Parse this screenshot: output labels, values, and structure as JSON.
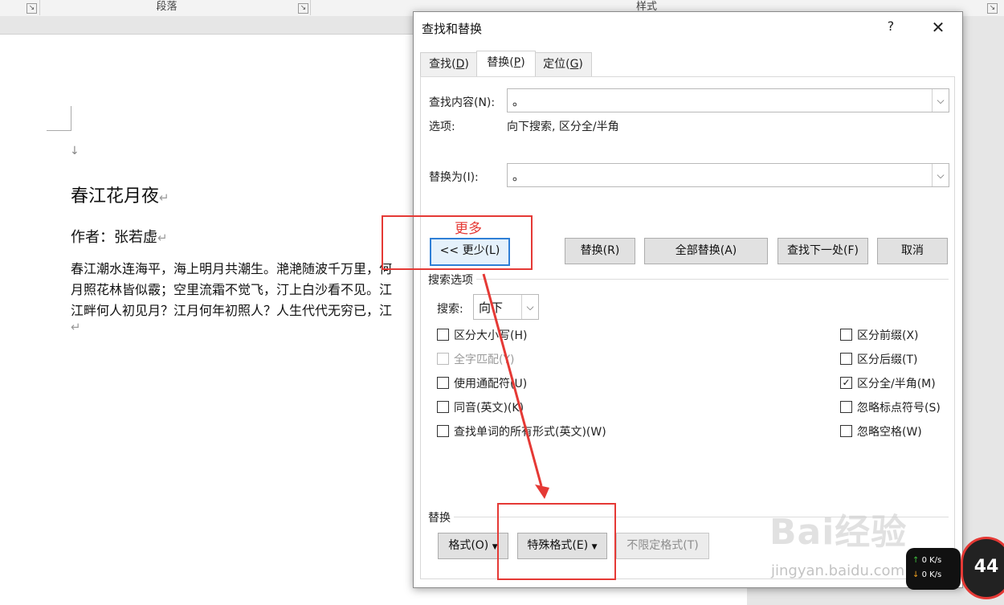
{
  "ribbon": {
    "group_paragraph": "段落",
    "group_styles": "样式",
    "launcher_glyph": "↘"
  },
  "document": {
    "title": "春江花月夜",
    "author": "作者：张若虚",
    "lines": [
      "春江潮水连海平，海上明月共潮生。滟滟随波千万里，何",
      "月照花林皆似霰；空里流霜不觉飞，汀上白沙看不见。江",
      "江畔何人初见月？江月何年初照人？人生代代无穷已，江"
    ],
    "pilcrow": "↵",
    "arrow": "↓"
  },
  "dialog": {
    "title": "查找和替换",
    "help": "?",
    "close": "✕",
    "tabs": [
      {
        "label": "查找(",
        "key": "D",
        "suffix": ")"
      },
      {
        "label": "替换(",
        "key": "P",
        "suffix": ")"
      },
      {
        "label": "定位(",
        "key": "G",
        "suffix": ")"
      }
    ],
    "find_label": "查找内容(N):",
    "find_value": "。",
    "options_label": "选项:",
    "options_value": "向下搜索, 区分全/半角",
    "replace_label": "替换为(I):",
    "replace_value": "。",
    "buttons": {
      "less": "<< 更少(L)",
      "replace": "替换(R)",
      "replace_all": "全部替换(A)",
      "find_next": "查找下一处(F)",
      "cancel": "取消"
    },
    "search_options_title": "搜索选项",
    "search_label": "搜索:",
    "search_value": "向下",
    "left_checks": [
      {
        "label": "区分大小写(H)",
        "checked": false,
        "disabled": false
      },
      {
        "label": "全字匹配(Y)",
        "checked": false,
        "disabled": true
      },
      {
        "label": "使用通配符(U)",
        "checked": false,
        "disabled": false
      },
      {
        "label": "同音(英文)(K)",
        "checked": false,
        "disabled": false
      },
      {
        "label": "查找单词的所有形式(英文)(W)",
        "checked": false,
        "disabled": false
      }
    ],
    "right_checks": [
      {
        "label": "区分前缀(X)",
        "checked": false
      },
      {
        "label": "区分后缀(T)",
        "checked": false
      },
      {
        "label": "区分全/半角(M)",
        "checked": true
      },
      {
        "label": "忽略标点符号(S)",
        "checked": false
      },
      {
        "label": "忽略空格(W)",
        "checked": false
      }
    ],
    "replace_section_title": "替换",
    "format_btn": "格式(O)",
    "special_btn": "特殊格式(E)",
    "no_format_btn": "不限定格式(T)"
  },
  "annotation": {
    "more_label": "更多",
    "color": "#e53935"
  },
  "watermark": {
    "brand": "Bai经验",
    "url": "jingyan.baidu.com"
  },
  "net_widget": {
    "up": "0 K/s",
    "down": "0 K/s",
    "cpu": "44"
  }
}
